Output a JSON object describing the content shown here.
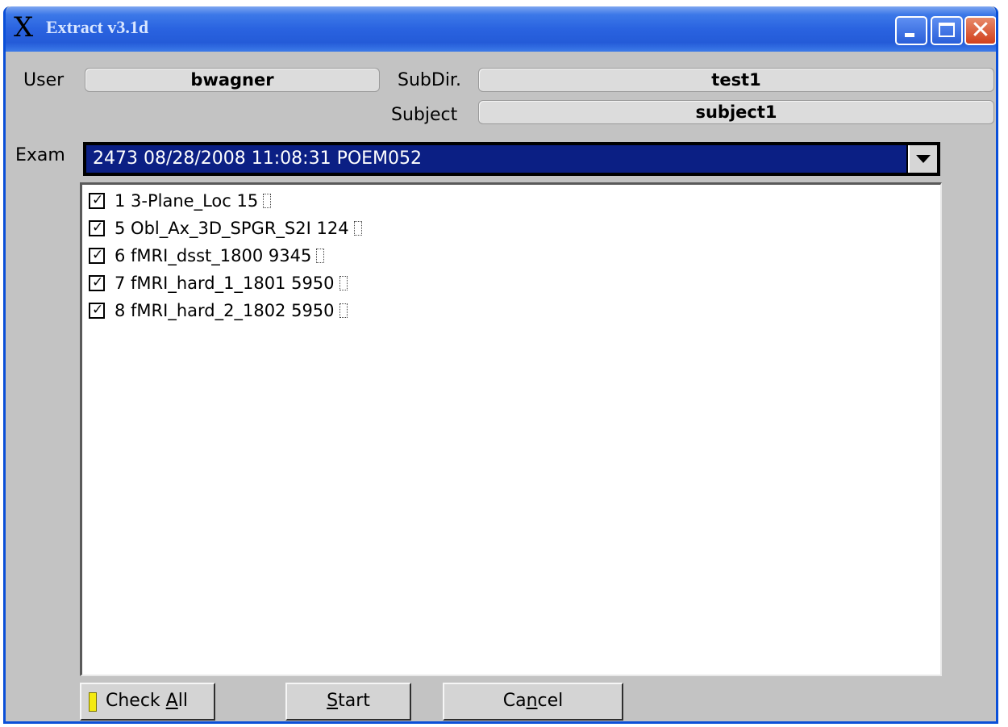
{
  "window": {
    "title": "Extract v3.1d",
    "title_icon": "X",
    "controls": [
      "minimize",
      "maximize",
      "close"
    ]
  },
  "form": {
    "user_label": "User",
    "user_value": "bwagner",
    "subdir_label": "SubDir.",
    "subdir_value": "test1",
    "subject_label": "Subject",
    "subject_value": "subject1",
    "exam_label": "Exam",
    "exam_value": "2473 08/28/2008 11:08:31 POEM052"
  },
  "series": [
    {
      "checked": true,
      "label": "1 3-Plane_Loc 15"
    },
    {
      "checked": true,
      "label": "5 Obl_Ax_3D_SPGR_S2I 124"
    },
    {
      "checked": true,
      "label": "6 fMRI_dsst_1800 9345"
    },
    {
      "checked": true,
      "label": "7 fMRI_hard_1_1801 5950"
    },
    {
      "checked": true,
      "label": "8 fMRI_hard_2_1802 5950"
    }
  ],
  "buttons": {
    "check_all_pre": "Check ",
    "check_all_mn": "A",
    "check_all_post": "ll",
    "start_mn": "S",
    "start_post": "tart",
    "cancel_pre": "Ca",
    "cancel_mn": "n",
    "cancel_post": "cel"
  },
  "colors": {
    "titlebar": "#245bd8",
    "exam_highlight": "#0b1f84",
    "window_bg": "#c3c3c3",
    "indicator": "#f4ea10"
  }
}
